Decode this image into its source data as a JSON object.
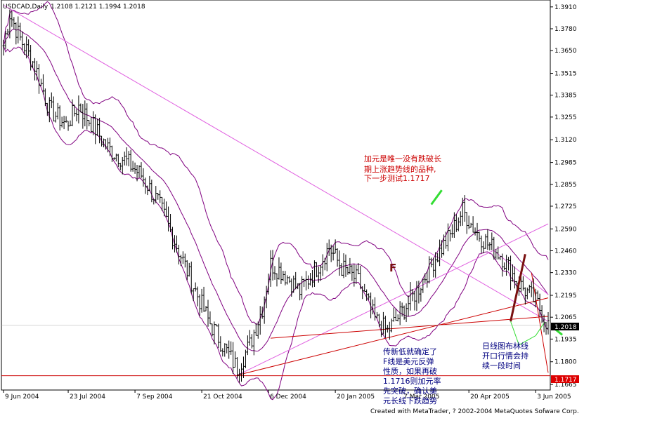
{
  "header": {
    "symbol": "USDCAD,Daily",
    "ohlc": "1.2108 1.2121 1.1994 1.2018"
  },
  "footer": {
    "credit": "Created with MetaTrader, ? 2002-2004 MetaQuotes Sofware Corp."
  },
  "chart_data": {
    "type": "candlestick",
    "y_ticks": [
      "1.3910",
      "1.3780",
      "1.3650",
      "1.3515",
      "1.3385",
      "1.3255",
      "1.3120",
      "1.2985",
      "1.2855",
      "1.2725",
      "1.2590",
      "1.2460",
      "1.2330",
      "1.2195",
      "1.2065",
      "1.1935",
      "1.1800",
      "1.1665"
    ],
    "ylim": [
      1.1632,
      1.3951
    ],
    "x_labels": [
      "9 Jun 2004",
      "23 Jul 2004",
      "7 Sep 2004",
      "21 Oct 2004",
      "6 Dec 2004",
      "20 Jan 2005",
      "7 Mar 2005",
      "20 Apr 2005",
      "3 Jun 2005"
    ],
    "current_price": "1.2018",
    "level_price": "1.1717",
    "pattern_label": "F",
    "annotations": {
      "top": [
        "加元是唯一没有跌破长",
        "期上涨趋势线的品种,",
        "下一步测试1.1717"
      ],
      "bottom": [
        "传新低就确定了",
        "F线是美元反弹",
        "性质，如果再破",
        "1.1716则加元率",
        "先突破，确认美",
        "元长线下跌趋势"
      ],
      "right": [
        "日线图布林线",
        "开口行情会持",
        "续一段时间"
      ]
    },
    "colors": {
      "candles": "#000000",
      "bollinger": "#800080",
      "trendline_pink": "#e060e0",
      "trendline_red": "#cc0000",
      "arrow": "#33dd33",
      "pattern": "#7a1010",
      "annotation_red": "#cc0000",
      "annotation_blue": "#000080"
    }
  }
}
